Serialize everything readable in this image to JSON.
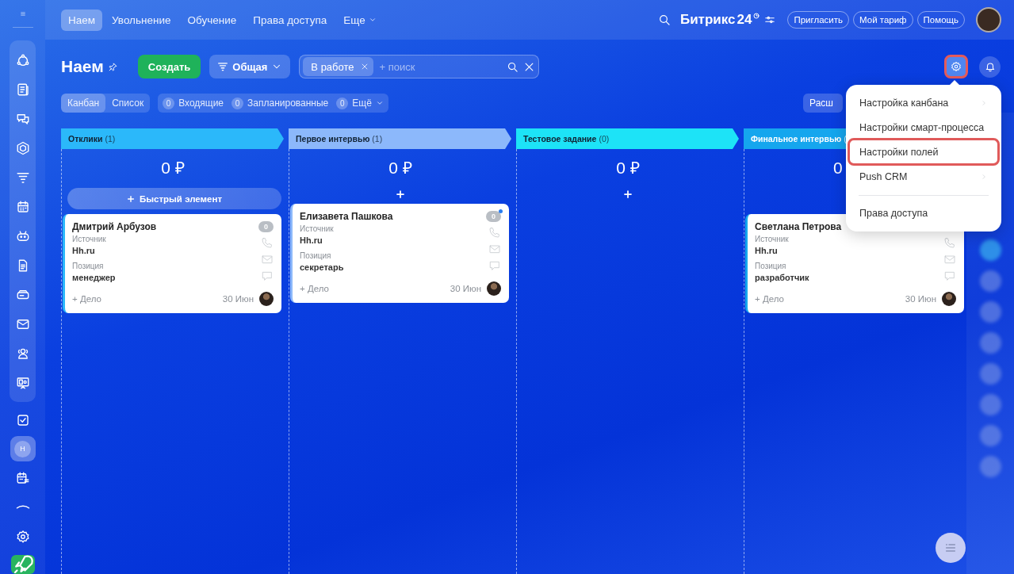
{
  "sidebar": {
    "pinned": [
      {
        "selected": false
      },
      {
        "selected": false
      },
      {
        "selected": false
      },
      {
        "selected": false
      },
      {
        "selected": false
      },
      {
        "selected": false
      },
      {
        "selected": false
      },
      {
        "selected": false
      },
      {
        "selected": false
      },
      {
        "selected": false
      },
      {
        "selected": false
      },
      {
        "selected": false
      }
    ],
    "items": [
      {
        "kind": "icon",
        "selected": false
      },
      {
        "kind": "avatar",
        "label": "Н",
        "selected": true
      },
      {
        "kind": "icon",
        "selected": false
      },
      {
        "kind": "icon",
        "selected": false
      },
      {
        "kind": "icon",
        "selected": false
      },
      {
        "kind": "app",
        "selected": false
      }
    ]
  },
  "top_nav": {
    "tabs": [
      {
        "label": "Наем",
        "selected": true,
        "kind": "tab"
      },
      {
        "label": "Увольнение",
        "selected": false,
        "kind": "tab"
      },
      {
        "label": "Обучение",
        "selected": false,
        "kind": "tab"
      },
      {
        "label": "Права доступа",
        "selected": false,
        "kind": "tab"
      },
      {
        "label": "Еще",
        "selected": false,
        "kind": "dropdown"
      }
    ],
    "logo": {
      "name": "Битрикс",
      "number": "24"
    },
    "buttons": [
      "Пригласить",
      "Мой тариф",
      "Помощь"
    ]
  },
  "page": {
    "title": "Наем",
    "create_button": "Создать",
    "category": "Общая",
    "filter": {
      "chips": [
        "В работе"
      ],
      "placeholder": "+ поиск"
    },
    "settings_highlighted": true
  },
  "views": [
    {
      "label": "Канбан",
      "selected": true
    },
    {
      "label": "Список",
      "selected": false
    }
  ],
  "counters": [
    {
      "count": "0",
      "label": "Входящие",
      "kind": "counter"
    },
    {
      "count": "0",
      "label": "Запланированные",
      "kind": "counter"
    },
    {
      "count": "0",
      "label": "Ещё",
      "kind": "dropdown"
    }
  ],
  "extra_button": "Расш",
  "columns": [
    {
      "title": "Отклики",
      "count": "(1)",
      "color": "#2bb8fa",
      "sum": "0 ₽",
      "add": {
        "kind": "quick",
        "label": "Быстрый элемент"
      },
      "cards": [
        {
          "name": "Дмитрий Арбузов",
          "fields": [
            {
              "label": "Источник",
              "value": "Hh.ru"
            },
            {
              "label": "Позиция",
              "value": "менеджер"
            }
          ],
          "counter": "0",
          "unread": false,
          "task": "+ Дело",
          "date": "30 Июн"
        }
      ]
    },
    {
      "title": "Первое интервью",
      "count": "(1)",
      "color": "#8cb8fb",
      "sum": "0 ₽",
      "add": {
        "kind": "plus"
      },
      "cards": [
        {
          "name": "Елизавета Пашкова",
          "fields": [
            {
              "label": "Источник",
              "value": "Hh.ru"
            },
            {
              "label": "Позиция",
              "value": "секретарь"
            }
          ],
          "counter": "0",
          "unread": true,
          "task": "+ Дело",
          "date": "30 Июн"
        }
      ]
    },
    {
      "title": "Тестовое задание",
      "count": "(0)",
      "color": "#1de3f7",
      "sum": "0 ₽",
      "add": {
        "kind": "plus"
      }
    },
    {
      "title": "Финальное интервью",
      "count": "(",
      "color": "#15a6ee",
      "sum": "0",
      "cards": [
        {
          "name": "Светлана Петрова",
          "fields": [
            {
              "label": "Источник",
              "value": "Hh.ru"
            },
            {
              "label": "Позиция",
              "value": "разработчик"
            }
          ],
          "task": "+ Дело",
          "date": "30 Июн"
        }
      ]
    }
  ],
  "recent_chats": [
    {
      "kind": "chat"
    },
    {
      "kind": "avatar"
    },
    {
      "kind": "avatar"
    },
    {
      "kind": "avatar"
    },
    {
      "kind": "avatar"
    },
    {
      "kind": "avatar"
    },
    {
      "kind": "avatar"
    },
    {
      "kind": "avatar"
    }
  ],
  "settings_menu": {
    "items": [
      {
        "label": "Настройка канбана",
        "submenu": true,
        "highlighted": false,
        "divider_before": false
      },
      {
        "label": "Настройки смарт-процесса",
        "submenu": false,
        "highlighted": false,
        "divider_before": false
      },
      {
        "label": "Настройки полей",
        "submenu": false,
        "highlighted": true,
        "divider_before": false
      },
      {
        "label": "Push CRM",
        "submenu": true,
        "highlighted": false,
        "divider_before": false
      },
      {
        "label": "Права доступа",
        "submenu": false,
        "highlighted": false,
        "divider_before": true
      }
    ]
  }
}
